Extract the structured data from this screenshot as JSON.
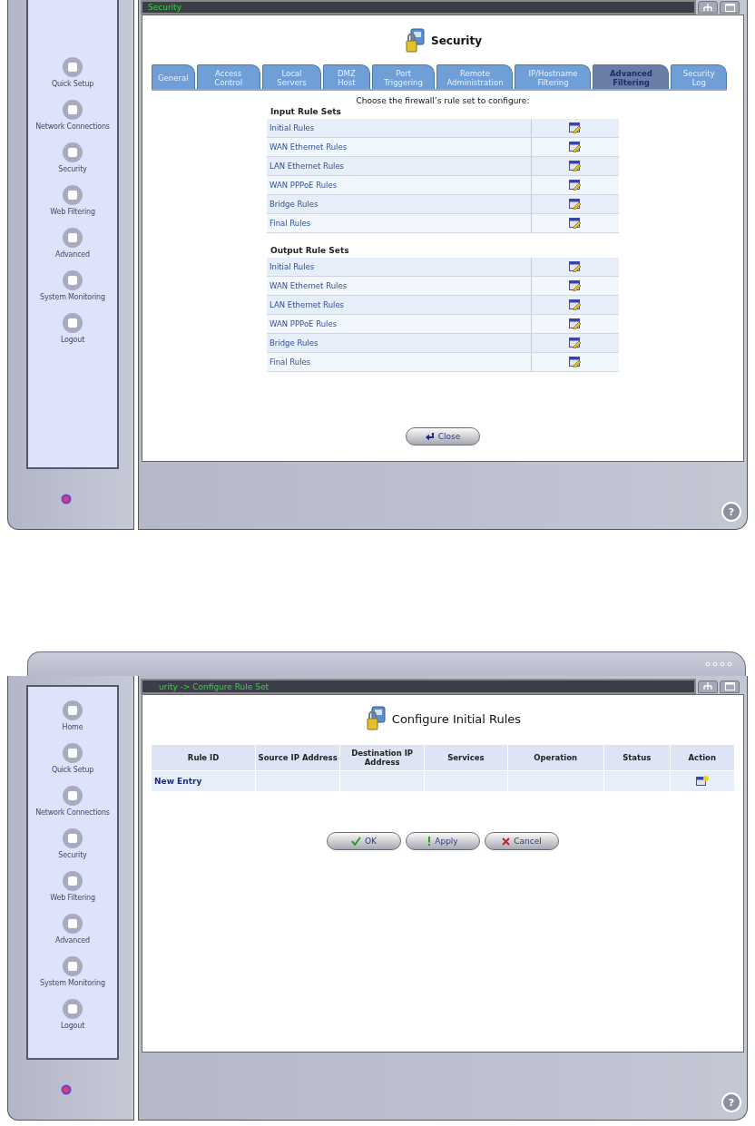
{
  "screens": [
    {
      "kind": "rule_sets",
      "address": "Security",
      "sidebar": [
        {
          "label": "Quick Setup"
        },
        {
          "label": "Network Connections"
        },
        {
          "label": "Security"
        },
        {
          "label": "Web Filtering"
        },
        {
          "label": "Advanced"
        },
        {
          "label": "System Monitoring"
        },
        {
          "label": "Logout"
        }
      ],
      "title": "Security",
      "tabs": [
        {
          "label": "General",
          "selected": false
        },
        {
          "label": "Access Control",
          "selected": false
        },
        {
          "label": "Local Servers",
          "selected": false
        },
        {
          "label": "DMZ Host",
          "selected": false
        },
        {
          "label": "Port Triggering",
          "selected": false
        },
        {
          "label": "Remote Administration",
          "selected": false
        },
        {
          "label": "IP/Hostname Filtering",
          "selected": false
        },
        {
          "label": "Advanced Filtering",
          "selected": true
        },
        {
          "label": "Security Log",
          "selected": false
        }
      ],
      "intro": "Choose the firewall’s rule set to configure:",
      "groups": [
        {
          "heading": "Input Rule Sets",
          "rows": [
            "Initial Rules",
            "WAN Ethernet Rules",
            "LAN Ethernet Rules",
            "WAN PPPoE Rules",
            "Bridge Rules",
            "Final Rules"
          ]
        },
        {
          "heading": "Output Rule Sets",
          "rows": [
            "Initial Rules",
            "WAN Ethernet Rules",
            "LAN Ethernet Rules",
            "WAN PPPoE Rules",
            "Bridge Rules",
            "Final Rules"
          ]
        }
      ],
      "buttons": [
        {
          "kind": "close",
          "label": "Close"
        }
      ],
      "help": "?"
    },
    {
      "kind": "rule_table",
      "address": "urity -> Configure Rule Set",
      "sidebar": [
        {
          "label": "Home"
        },
        {
          "label": "Quick Setup"
        },
        {
          "label": "Network Connections"
        },
        {
          "label": "Security"
        },
        {
          "label": "Web Filtering"
        },
        {
          "label": "Advanced"
        },
        {
          "label": "System Monitoring"
        },
        {
          "label": "Logout"
        }
      ],
      "title": "Configure Initial Rules",
      "columns": [
        "Rule ID",
        "Source IP Address",
        "Destination IP Address",
        "Services",
        "Operation",
        "Status",
        "Action"
      ],
      "rows": [
        {
          "rule_id": "New Entry"
        }
      ],
      "buttons": [
        {
          "kind": "ok",
          "label": "OK"
        },
        {
          "kind": "apply",
          "label": "Apply"
        },
        {
          "kind": "cancel",
          "label": "Cancel"
        }
      ],
      "help": "?"
    }
  ]
}
